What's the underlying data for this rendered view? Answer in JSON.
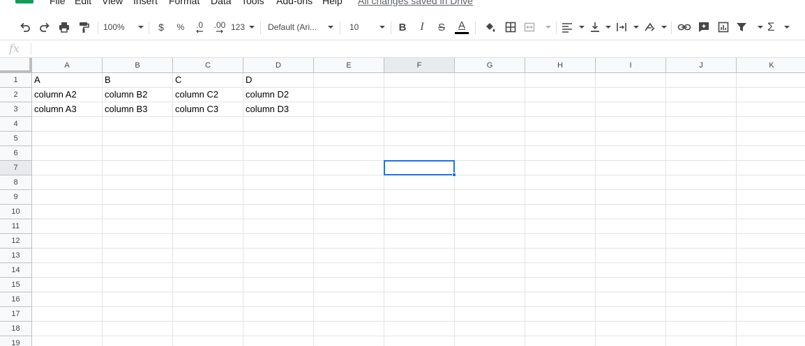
{
  "menu": {
    "items": [
      "File",
      "Edit",
      "View",
      "Insert",
      "Format",
      "Data",
      "Tools",
      "Add-ons",
      "Help"
    ],
    "saved_status": "All changes saved in Drive"
  },
  "toolbar": {
    "zoom": "100%",
    "currency": "$",
    "percent": "%",
    "decrease_decimal": ".0",
    "increase_decimal": ".00",
    "more_formats": "123",
    "font": "Default (Ari...",
    "font_size": "10",
    "bold": "B",
    "italic": "I",
    "strikethrough": "S",
    "text_color": "A",
    "sum": "Σ",
    "text_color_swatch": "#000000"
  },
  "formula_bar": {
    "icon": "fx",
    "value": ""
  },
  "grid": {
    "columns": [
      "A",
      "B",
      "C",
      "D",
      "E",
      "F",
      "G",
      "H",
      "I",
      "J",
      "K"
    ],
    "rows": [
      "1",
      "2",
      "3",
      "4",
      "5",
      "6",
      "7",
      "8",
      "9",
      "10",
      "11",
      "12",
      "13",
      "14",
      "15",
      "16",
      "17",
      "18",
      "19"
    ],
    "cells": [
      [
        "A",
        "B",
        "C",
        "D"
      ],
      [
        "column A2",
        "column B2",
        "column C2",
        "column D2"
      ],
      [
        "column A3",
        "column B3",
        "column C3",
        "column D3"
      ]
    ],
    "selected_cell": "F7",
    "selection_color": "#1a73e8"
  }
}
